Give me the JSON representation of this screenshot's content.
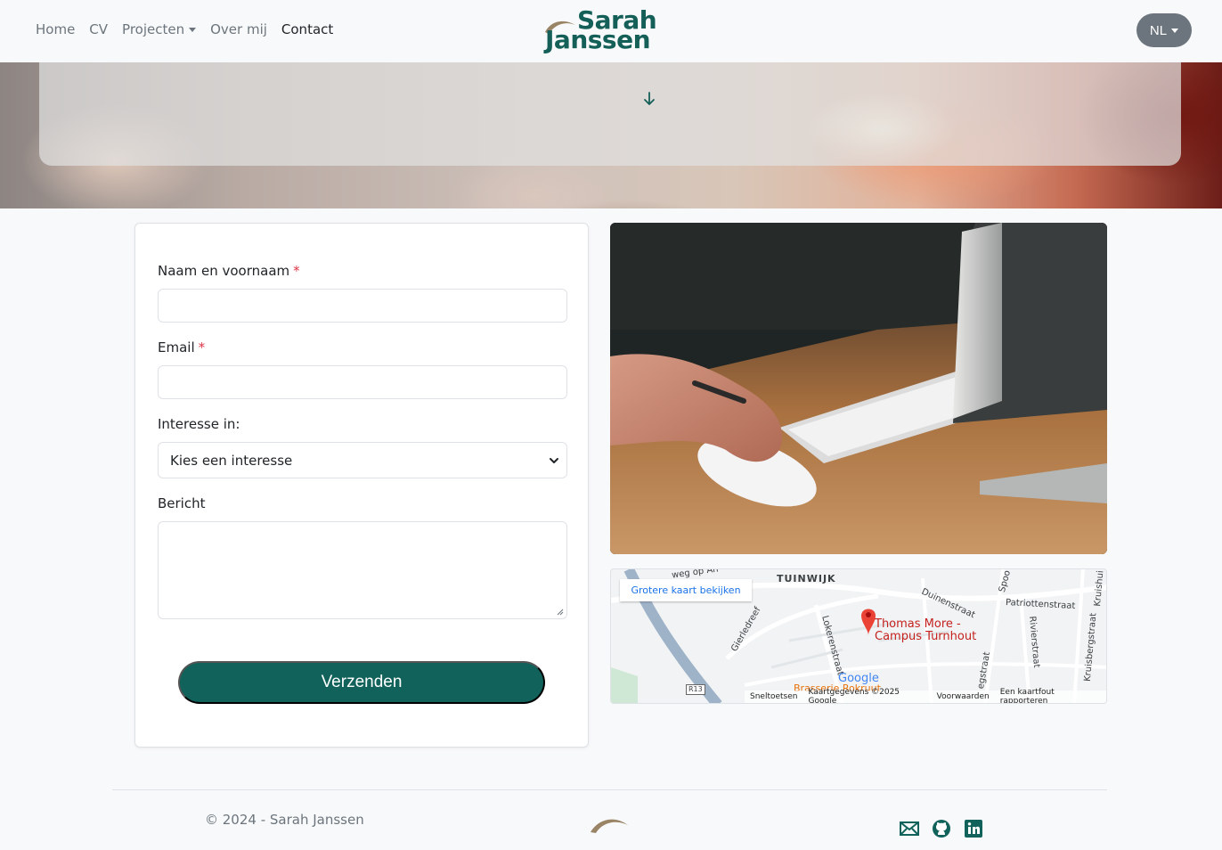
{
  "nav": {
    "items": [
      {
        "label": "Home",
        "active": false,
        "dropdown": false
      },
      {
        "label": "CV",
        "active": false,
        "dropdown": false
      },
      {
        "label": "Projecten",
        "active": false,
        "dropdown": true
      },
      {
        "label": "Over mij",
        "active": false,
        "dropdown": false
      },
      {
        "label": "Contact",
        "active": true,
        "dropdown": false
      }
    ],
    "logo_line1": "Sarah",
    "logo_line2": "Janssen",
    "language": "NL"
  },
  "hero": {
    "icon": "arrow-down-icon"
  },
  "form": {
    "name_label": "Naam en voornaam",
    "email_label": "Email",
    "required_mark": "*",
    "interest_label": "Interesse in:",
    "interest_selected": "Kies een interesse",
    "message_label": "Bericht",
    "submit_label": "Verzenden",
    "name_value": "",
    "email_value": "",
    "message_value": ""
  },
  "map": {
    "larger_map_link": "Grotere kaart bekijken",
    "place_name_line1": "Thomas More -",
    "place_name_line2": "Campus Turnhout",
    "labels": [
      "TUINWIJK",
      "Duinenstraat",
      "Patriottenstraat",
      "Rivierstraat",
      "Kruisbergstraat",
      "Lokerenstraat",
      "Gierledreef",
      "Spoo",
      "Kruishui",
      "R13",
      "Brasserie Rokruut",
      "egstraat",
      "weg op An"
    ],
    "attribution": [
      "Sneltoetsen",
      "Kaartgegevens ©2025 Google",
      "Voorwaarden",
      "Een kaartfout rapporteren"
    ],
    "brand": "Google"
  },
  "footer": {
    "copyright": "© 2024 - Sarah Janssen",
    "social": [
      "mail-icon",
      "github-icon",
      "linkedin-icon"
    ]
  },
  "colors": {
    "brand": "#10625b",
    "logo_swoosh": "#9a8466",
    "language_button": "#6c757d",
    "required": "#dc3545"
  }
}
